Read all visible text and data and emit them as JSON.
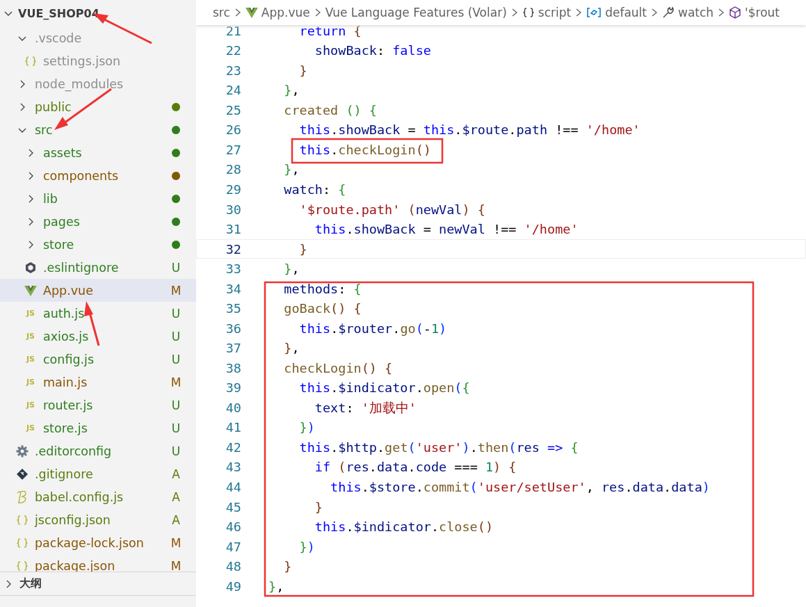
{
  "explorer": {
    "title": "VUE_SHOP04",
    "expanded": true,
    "items": [
      {
        "name": ".vscode",
        "kind": "folder",
        "color": "#8e8e90",
        "dot": false,
        "expanded": true,
        "selected": false,
        "children": [
          {
            "name": "settings.json",
            "kind": "json",
            "color": "#8e8e90",
            "selected": false
          }
        ]
      },
      {
        "name": "node_modules",
        "kind": "folder",
        "color": "#8e8e90",
        "dot": false,
        "expanded": false,
        "selected": false
      },
      {
        "name": "public",
        "kind": "folder",
        "color": "#587c0c",
        "dot": true,
        "expanded": false,
        "selected": false
      },
      {
        "name": "src",
        "kind": "folder",
        "color": "#2f7d1f",
        "dot": true,
        "expanded": true,
        "selected": false,
        "children": [
          {
            "name": "assets",
            "kind": "folder",
            "color": "#2f7d1f",
            "dot": true,
            "expanded": false,
            "selected": false
          },
          {
            "name": "components",
            "kind": "folder",
            "color": "#895503",
            "dot": true,
            "expanded": false,
            "selected": false
          },
          {
            "name": "lib",
            "kind": "folder",
            "color": "#2f7d1f",
            "dot": true,
            "expanded": false,
            "selected": false
          },
          {
            "name": "pages",
            "kind": "folder",
            "color": "#2f7d1f",
            "dot": true,
            "expanded": false,
            "selected": false
          },
          {
            "name": "store",
            "kind": "folder",
            "color": "#2f7d1f",
            "dot": true,
            "expanded": false,
            "selected": false
          },
          {
            "name": ".eslintignore",
            "kind": "eslint",
            "color": "#2f7d1f",
            "badge": "U",
            "selected": false
          },
          {
            "name": "App.vue",
            "kind": "vue",
            "color": "#895503",
            "badge": "M",
            "selected": true
          },
          {
            "name": "auth.js",
            "kind": "js",
            "icon_text": "JS",
            "color": "#2f7d1f",
            "badge": "U",
            "selected": false
          },
          {
            "name": "axios.js",
            "kind": "js",
            "icon_text": "JS",
            "color": "#2f7d1f",
            "badge": "U",
            "selected": false
          },
          {
            "name": "config.js",
            "kind": "js",
            "icon_text": "JS",
            "color": "#2f7d1f",
            "badge": "U",
            "selected": false
          },
          {
            "name": "main.js",
            "kind": "js",
            "icon_text": "JS",
            "color": "#895503",
            "badge": "M",
            "selected": false
          },
          {
            "name": "router.js",
            "kind": "js",
            "icon_text": "JS",
            "color": "#2f7d1f",
            "badge": "U",
            "selected": false
          },
          {
            "name": "store.js",
            "kind": "js",
            "icon_text": "JS",
            "color": "#2f7d1f",
            "badge": "U",
            "selected": false
          }
        ]
      },
      {
        "name": ".editorconfig",
        "kind": "gear",
        "color": "#2f7d1f",
        "badge": "U",
        "selected": false
      },
      {
        "name": ".gitignore",
        "kind": "git",
        "color": "#587c0c",
        "badge": "A",
        "selected": false
      },
      {
        "name": "babel.config.js",
        "kind": "babel",
        "color": "#587c0c",
        "badge": "A",
        "selected": false
      },
      {
        "name": "jsconfig.json",
        "kind": "json",
        "color": "#587c0c",
        "badge": "A",
        "selected": false
      },
      {
        "name": "package-lock.json",
        "kind": "json",
        "color": "#895503",
        "badge": "M",
        "selected": false
      },
      {
        "name": "package.json",
        "kind": "json",
        "color": "#895503",
        "badge": "M",
        "selected": false
      }
    ]
  },
  "panels": [
    {
      "title": "大纲",
      "expanded": false
    }
  ],
  "breadcrumb": [
    {
      "kind": "folder",
      "text": "src"
    },
    {
      "kind": "vue",
      "text": "App.vue"
    },
    {
      "kind": "plain",
      "text": "Vue Language Features (Volar)"
    },
    {
      "kind": "braces",
      "text": "script"
    },
    {
      "kind": "module",
      "text": "default"
    },
    {
      "kind": "wrench",
      "text": "watch"
    },
    {
      "kind": "cube",
      "text": "'$rout"
    }
  ],
  "code_lines": [
    {
      "number": "21",
      "current": false,
      "tokens": [
        {
          "kind": "kw",
          "text": "    return"
        },
        {
          "kind": "b3",
          "text": " {"
        }
      ]
    },
    {
      "number": "22",
      "current": false,
      "tokens": [
        {
          "kind": "prop",
          "text": "      showBack"
        },
        {
          "kind": "p",
          "text": ": "
        },
        {
          "kind": "kw",
          "text": "false"
        }
      ]
    },
    {
      "number": "23",
      "current": false,
      "tokens": [
        {
          "kind": "b3",
          "text": "    }"
        }
      ]
    },
    {
      "number": "24",
      "current": false,
      "tokens": [
        {
          "kind": "b2",
          "text": "  }"
        },
        {
          "kind": "p",
          "text": ","
        }
      ]
    },
    {
      "number": "25",
      "current": false,
      "tokens": [
        {
          "kind": "fn",
          "text": "  created "
        },
        {
          "kind": "b2",
          "text": "() {"
        }
      ]
    },
    {
      "number": "26",
      "current": false,
      "tokens": [
        {
          "kind": "kw",
          "text": "    this"
        },
        {
          "kind": "p",
          "text": "."
        },
        {
          "kind": "prop",
          "text": "showBack"
        },
        {
          "kind": "p",
          "text": " = "
        },
        {
          "kind": "kw",
          "text": "this"
        },
        {
          "kind": "p",
          "text": "."
        },
        {
          "kind": "prop",
          "text": "$route"
        },
        {
          "kind": "p",
          "text": "."
        },
        {
          "kind": "prop",
          "text": "path"
        },
        {
          "kind": "p",
          "text": " !== "
        },
        {
          "kind": "str",
          "text": "'/home'"
        }
      ]
    },
    {
      "number": "27",
      "current": false,
      "tokens": [
        {
          "kind": "kw",
          "text": "    this"
        },
        {
          "kind": "p",
          "text": "."
        },
        {
          "kind": "fn",
          "text": "checkLogin"
        },
        {
          "kind": "b3",
          "text": "()"
        }
      ]
    },
    {
      "number": "28",
      "current": false,
      "tokens": [
        {
          "kind": "b2",
          "text": "  }"
        },
        {
          "kind": "p",
          "text": ","
        }
      ]
    },
    {
      "number": "29",
      "current": false,
      "tokens": [
        {
          "kind": "prop",
          "text": "  watch"
        },
        {
          "kind": "p",
          "text": ": "
        },
        {
          "kind": "b2",
          "text": "{"
        }
      ]
    },
    {
      "number": "30",
      "current": false,
      "tokens": [
        {
          "kind": "str",
          "text": "    '$route.path' "
        },
        {
          "kind": "b3",
          "text": "("
        },
        {
          "kind": "prop",
          "text": "newVal"
        },
        {
          "kind": "b3",
          "text": ") {"
        }
      ]
    },
    {
      "number": "31",
      "current": false,
      "tokens": [
        {
          "kind": "kw",
          "text": "      this"
        },
        {
          "kind": "p",
          "text": "."
        },
        {
          "kind": "prop",
          "text": "showBack"
        },
        {
          "kind": "p",
          "text": " = "
        },
        {
          "kind": "prop",
          "text": "newVal"
        },
        {
          "kind": "p",
          "text": " !== "
        },
        {
          "kind": "str",
          "text": "'/home'"
        }
      ]
    },
    {
      "number": "32",
      "current": true,
      "tokens": [
        {
          "kind": "b3",
          "text": "    }"
        }
      ]
    },
    {
      "number": "33",
      "current": false,
      "tokens": [
        {
          "kind": "b2",
          "text": "  }"
        },
        {
          "kind": "p",
          "text": ","
        }
      ]
    },
    {
      "number": "34",
      "current": false,
      "tokens": [
        {
          "kind": "prop",
          "text": "  methods"
        },
        {
          "kind": "p",
          "text": ": "
        },
        {
          "kind": "b2",
          "text": "{"
        }
      ]
    },
    {
      "number": "35",
      "current": false,
      "tokens": [
        {
          "kind": "fn",
          "text": "  goBack"
        },
        {
          "kind": "b3",
          "text": "() {"
        }
      ]
    },
    {
      "number": "36",
      "current": false,
      "tokens": [
        {
          "kind": "kw",
          "text": "    this"
        },
        {
          "kind": "p",
          "text": "."
        },
        {
          "kind": "prop",
          "text": "$router"
        },
        {
          "kind": "p",
          "text": "."
        },
        {
          "kind": "fn",
          "text": "go"
        },
        {
          "kind": "b1",
          "text": "("
        },
        {
          "kind": "p",
          "text": "-"
        },
        {
          "kind": "num",
          "text": "1"
        },
        {
          "kind": "b1",
          "text": ")"
        }
      ]
    },
    {
      "number": "37",
      "current": false,
      "tokens": [
        {
          "kind": "b3",
          "text": "  }"
        },
        {
          "kind": "p",
          "text": ","
        }
      ]
    },
    {
      "number": "38",
      "current": false,
      "tokens": [
        {
          "kind": "fn",
          "text": "  checkLogin"
        },
        {
          "kind": "b3",
          "text": "() {"
        }
      ]
    },
    {
      "number": "39",
      "current": false,
      "tokens": [
        {
          "kind": "kw",
          "text": "    this"
        },
        {
          "kind": "p",
          "text": "."
        },
        {
          "kind": "prop",
          "text": "$indicator"
        },
        {
          "kind": "p",
          "text": "."
        },
        {
          "kind": "fn",
          "text": "open"
        },
        {
          "kind": "b1",
          "text": "("
        },
        {
          "kind": "b2",
          "text": "{"
        }
      ]
    },
    {
      "number": "40",
      "current": false,
      "tokens": [
        {
          "kind": "prop",
          "text": "      text"
        },
        {
          "kind": "p",
          "text": ": "
        },
        {
          "kind": "str",
          "text": "'加载中'"
        }
      ]
    },
    {
      "number": "41",
      "current": false,
      "tokens": [
        {
          "kind": "b2",
          "text": "    }"
        },
        {
          "kind": "b1",
          "text": ")"
        }
      ]
    },
    {
      "number": "42",
      "current": false,
      "tokens": [
        {
          "kind": "kw",
          "text": "    this"
        },
        {
          "kind": "p",
          "text": "."
        },
        {
          "kind": "prop",
          "text": "$http"
        },
        {
          "kind": "p",
          "text": "."
        },
        {
          "kind": "fn",
          "text": "get"
        },
        {
          "kind": "b1",
          "text": "("
        },
        {
          "kind": "str",
          "text": "'user'"
        },
        {
          "kind": "b1",
          "text": ")"
        },
        {
          "kind": "p",
          "text": "."
        },
        {
          "kind": "fn",
          "text": "then"
        },
        {
          "kind": "b1",
          "text": "("
        },
        {
          "kind": "prop",
          "text": "res "
        },
        {
          "kind": "kw",
          "text": "=>"
        },
        {
          "kind": "b2",
          "text": " {"
        }
      ]
    },
    {
      "number": "43",
      "current": false,
      "tokens": [
        {
          "kind": "kw",
          "text": "      if "
        },
        {
          "kind": "b3",
          "text": "("
        },
        {
          "kind": "prop",
          "text": "res"
        },
        {
          "kind": "p",
          "text": "."
        },
        {
          "kind": "prop",
          "text": "data"
        },
        {
          "kind": "p",
          "text": "."
        },
        {
          "kind": "prop",
          "text": "code"
        },
        {
          "kind": "p",
          "text": " === "
        },
        {
          "kind": "num",
          "text": "1"
        },
        {
          "kind": "b3",
          "text": ") {"
        }
      ]
    },
    {
      "number": "44",
      "current": false,
      "tokens": [
        {
          "kind": "kw",
          "text": "        this"
        },
        {
          "kind": "p",
          "text": "."
        },
        {
          "kind": "prop",
          "text": "$store"
        },
        {
          "kind": "p",
          "text": "."
        },
        {
          "kind": "fn",
          "text": "commit"
        },
        {
          "kind": "b1",
          "text": "("
        },
        {
          "kind": "str",
          "text": "'user/setUser'"
        },
        {
          "kind": "p",
          "text": ", "
        },
        {
          "kind": "prop",
          "text": "res"
        },
        {
          "kind": "p",
          "text": "."
        },
        {
          "kind": "prop",
          "text": "data"
        },
        {
          "kind": "p",
          "text": "."
        },
        {
          "kind": "prop",
          "text": "data"
        },
        {
          "kind": "b1",
          "text": ")"
        }
      ]
    },
    {
      "number": "45",
      "current": false,
      "tokens": [
        {
          "kind": "b3",
          "text": "      }"
        }
      ]
    },
    {
      "number": "46",
      "current": false,
      "tokens": [
        {
          "kind": "kw",
          "text": "      this"
        },
        {
          "kind": "p",
          "text": "."
        },
        {
          "kind": "prop",
          "text": "$indicator"
        },
        {
          "kind": "p",
          "text": "."
        },
        {
          "kind": "fn",
          "text": "close"
        },
        {
          "kind": "b3",
          "text": "()"
        }
      ]
    },
    {
      "number": "47",
      "current": false,
      "tokens": [
        {
          "kind": "b2",
          "text": "    }"
        },
        {
          "kind": "b1",
          "text": ")"
        }
      ]
    },
    {
      "number": "48",
      "current": false,
      "tokens": [
        {
          "kind": "b3",
          "text": "  }"
        }
      ]
    },
    {
      "number": "49",
      "current": false,
      "tokens": [
        {
          "kind": "b2",
          "text": "}"
        },
        {
          "kind": "p",
          "text": ","
        }
      ]
    }
  ]
}
